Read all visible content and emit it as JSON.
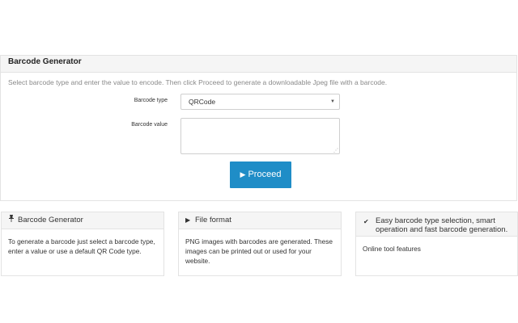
{
  "panel": {
    "title": "Barcode Generator",
    "intro": "Select barcode type and enter the value to encode. Then click Proceed to generate a downloadable Jpeg file with a barcode.",
    "type_label": "Barcode type",
    "type_value": "QRCode",
    "value_label": "Barcode value",
    "value_text": "",
    "proceed_label": "Proceed"
  },
  "cards": [
    {
      "icon": "pin-icon",
      "title": "Barcode Generator",
      "body": "To generate a barcode just select a barcode type, enter a value or use a default QR Code type."
    },
    {
      "icon": "play-icon",
      "title": "File format",
      "body": "PNG images with barcodes are generated. These images can be printed out or used for your website."
    },
    {
      "icon": "checkmark-icon",
      "title": "Easy barcode type selection, smart operation and fast barcode generation.",
      "body": "Online tool features"
    }
  ],
  "colors": {
    "accent": "#1f8dc7",
    "heading_bg": "#f5f5f5"
  }
}
